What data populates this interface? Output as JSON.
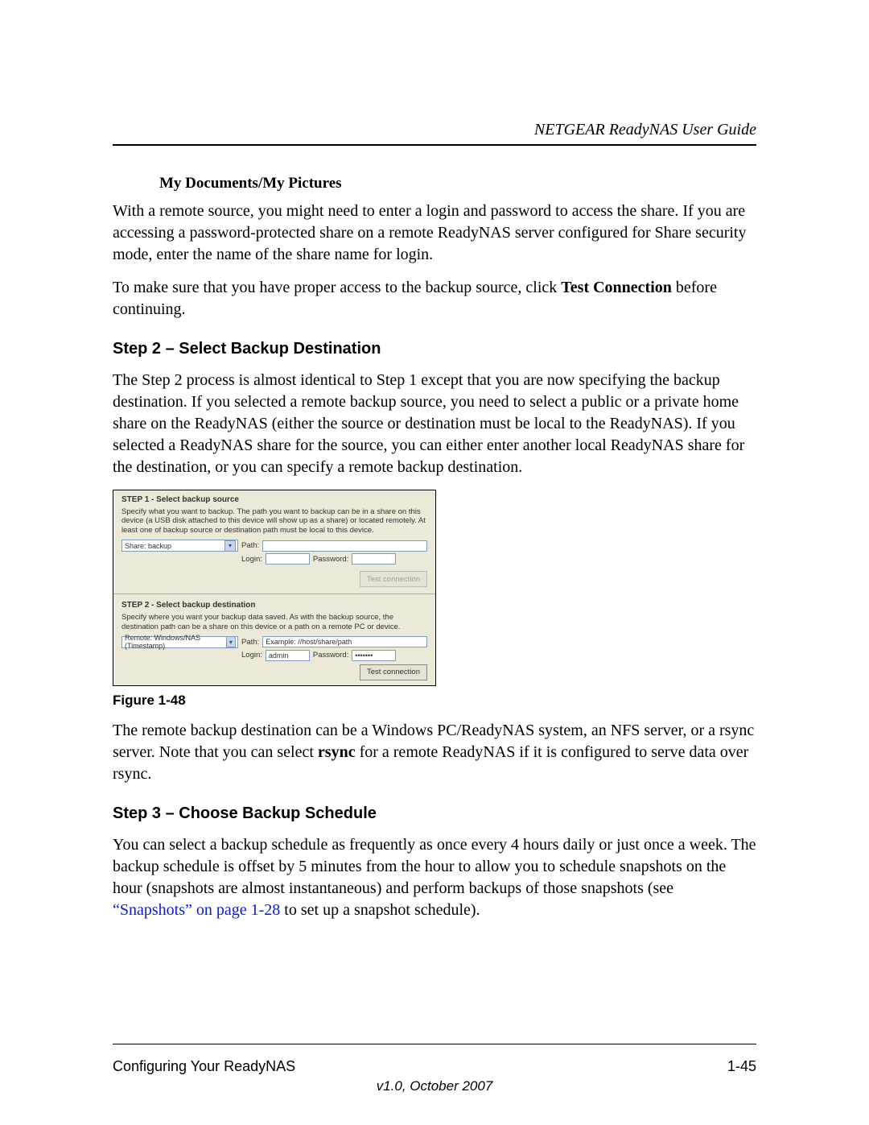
{
  "header": {
    "title": "NETGEAR ReadyNAS User Guide"
  },
  "sectionA": {
    "subheading": "My Documents/My Pictures",
    "p1_a": "With a remote source, you might need to enter a login and password to access the share. If you are accessing a password-protected share on a remote ReadyNAS server configured for Share security mode, enter the name of the share name for login.",
    "p2_a": "To make sure that you have proper access to the backup source, click ",
    "p2_bold": "Test Connection",
    "p2_b": " before continuing."
  },
  "step2": {
    "heading": "Step 2 – Select Backup Destination",
    "p1": "The Step 2 process is almost identical to Step 1 except that you are now specifying the backup destination. If you selected a remote backup source, you need to select a public or a private home share on the ReadyNAS (either the source or destination must be local to the ReadyNAS). If you selected a ReadyNAS share for the source, you can either enter another local ReadyNAS share for the destination, or you can specify a remote backup destination."
  },
  "figure": {
    "s1": {
      "title": "STEP 1 - Select backup source",
      "desc": "Specify what you want to backup. The path you want to backup can be in a share on this device (a USB disk attached to this device will show up as a share) or located remotely. At least one of backup source or destination path must be local to this device.",
      "select": "Share: backup",
      "path_label": "Path:",
      "login_label": "Login:",
      "password_label": "Password:",
      "button": "Test connection"
    },
    "s2": {
      "title": "STEP 2 - Select backup destination",
      "desc": "Specify where you want your backup data saved. As with the backup source, the destination path can be a share on this device or a path on a remote PC or device.",
      "select": "Remote: Windows/NAS (Timestamp)",
      "path_label": "Path:",
      "path_value": "Example: //host/share/path",
      "login_label": "Login:",
      "login_value": "admin",
      "password_label": "Password:",
      "password_value": "•••••••",
      "button": "Test connection"
    },
    "caption": "Figure 1-48"
  },
  "afterFigure": {
    "p_a": "The remote backup destination can be a Windows PC/ReadyNAS system, an NFS server, or a rsync server. Note that you can select ",
    "p_bold": "rsync",
    "p_b": " for a remote ReadyNAS if it is configured to serve data over rsync."
  },
  "step3": {
    "heading": "Step 3 – Choose Backup Schedule",
    "p_a": "You can select a backup schedule as frequently as once every 4 hours daily or just once a week. The backup schedule is offset by 5 minutes from the hour to allow you to schedule snapshots on the hour (snapshots are almost instantaneous) and perform backups of those snapshots (see ",
    "link": "“Snapshots” on page 1-28",
    "p_b": " to set up a snapshot schedule)."
  },
  "footer": {
    "left": "Configuring Your ReadyNAS",
    "right": "1-45",
    "version": "v1.0, October 2007"
  }
}
